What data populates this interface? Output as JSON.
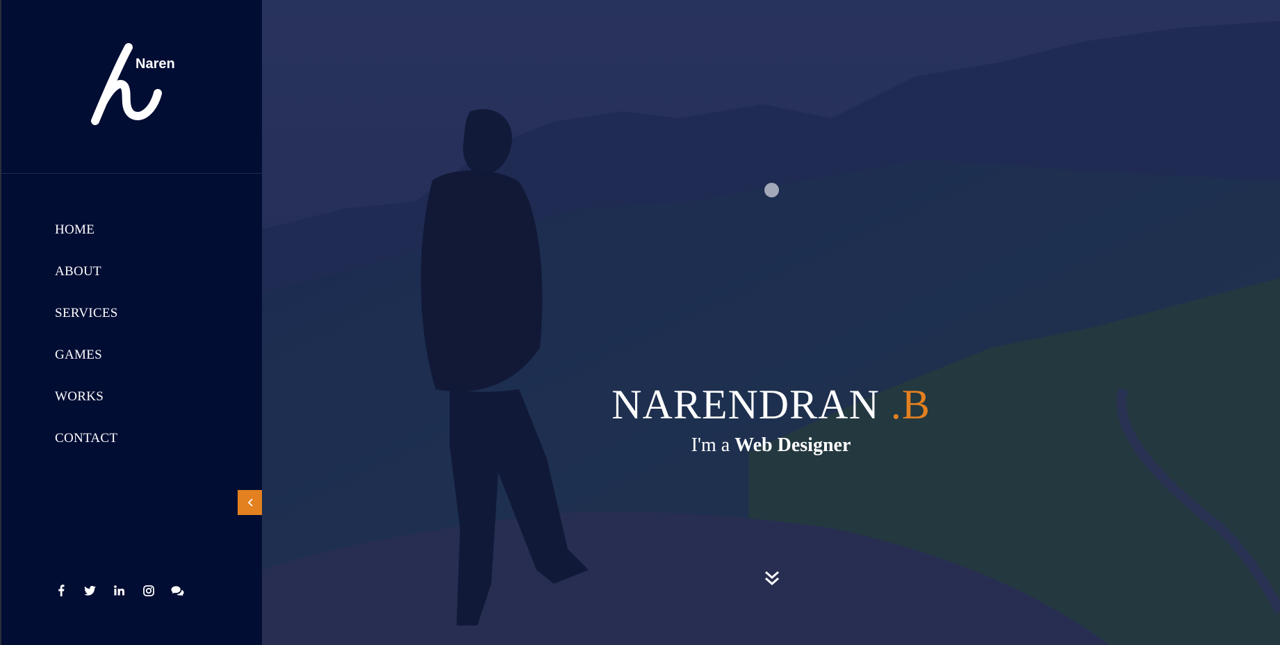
{
  "brand": {
    "logo_text": "Naren"
  },
  "nav": {
    "items": [
      {
        "label": "HOME"
      },
      {
        "label": "ABOUT"
      },
      {
        "label": "SERVICES"
      },
      {
        "label": "GAMES"
      },
      {
        "label": "WORKS"
      },
      {
        "label": "CONTACT"
      }
    ]
  },
  "sidebar": {
    "collapse_icon": "chevron-left-icon"
  },
  "socials": [
    "facebook-icon",
    "twitter-icon",
    "linkedin-icon",
    "instagram-icon",
    "chat-icon"
  ],
  "hero": {
    "name": "NARENDRAN",
    "name_accent": ".B",
    "subtitle_prefix": "I'm a",
    "subtitle_role": "Web Designer",
    "scroll_icon": "double-chevron-down-icon"
  },
  "colors": {
    "sidebar_bg": "#020d33",
    "accent": "#e3801f",
    "text": "#ffffff"
  }
}
